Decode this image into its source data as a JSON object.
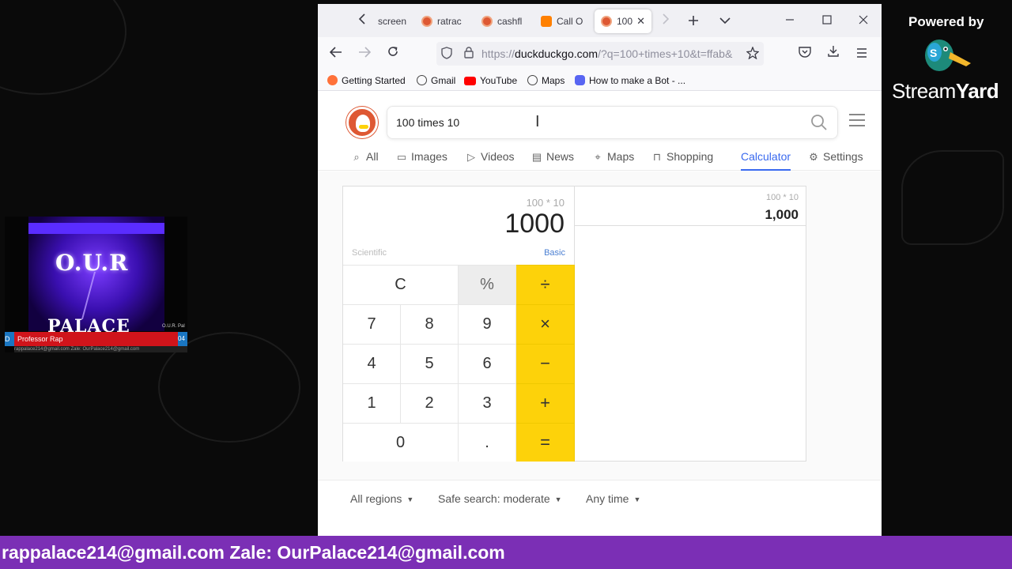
{
  "overlay": {
    "powered_by": "Powered by",
    "brand_light": "Stream",
    "brand_bold": "Yard",
    "footer_text": "rappalace214@gmail.com Zale: OurPalace214@gmail.com",
    "colors": {
      "footer_bg": "#7b2fb5",
      "lower_third": "#d0141b"
    }
  },
  "camera": {
    "title_line1": "O.U.R",
    "title_line2": "PALACE",
    "corner_text": "O.U.R. Pal",
    "lower_third_left": "D",
    "lower_third_name": "Professor Rap",
    "lower_third_right": "04",
    "ticker": "rappalace214@gmail.com Zale: OurPalace214@gmail.com"
  },
  "browser": {
    "tabs": [
      {
        "label": "screen",
        "icon": "generic-icon",
        "active": false
      },
      {
        "label": "ratrac",
        "icon": "duckduckgo-icon",
        "active": false
      },
      {
        "label": "cashfl",
        "icon": "duckduckgo-icon",
        "active": false
      },
      {
        "label": "Call O",
        "icon": "blogger-icon",
        "active": false
      },
      {
        "label": "100",
        "icon": "duckduckgo-icon",
        "active": true
      }
    ],
    "url_prefix": "https://",
    "url_host": "duckduckgo.com",
    "url_rest": "/?q=100+times+10&t=ffab&",
    "bookmarks": [
      {
        "label": "Getting Started",
        "icon": "firefox-icon",
        "color": "#ff7139"
      },
      {
        "label": "Gmail",
        "icon": "globe-icon",
        "color": "#ffffff"
      },
      {
        "label": "YouTube",
        "icon": "youtube-icon",
        "color": "#ff0000"
      },
      {
        "label": "Maps",
        "icon": "globe-icon",
        "color": "#ffffff"
      },
      {
        "label": "How to make a Bot - ...",
        "icon": "discord-icon",
        "color": "#5865f2"
      }
    ]
  },
  "search": {
    "query": "100 times 10",
    "tabs": [
      {
        "label": "All",
        "icon": "search-icon"
      },
      {
        "label": "Images",
        "icon": "image-icon"
      },
      {
        "label": "Videos",
        "icon": "play-icon"
      },
      {
        "label": "News",
        "icon": "news-icon"
      },
      {
        "label": "Maps",
        "icon": "pin-icon"
      },
      {
        "label": "Shopping",
        "icon": "bag-icon"
      },
      {
        "label": "Calculator",
        "icon": "",
        "active": true
      },
      {
        "label": "Settings",
        "icon": "sliders-icon"
      }
    ],
    "accent": "#3969ef"
  },
  "calculator": {
    "expression": "100 * 10",
    "result": "1000",
    "mode_left": "Scientific",
    "mode_right": "Basic",
    "keys": {
      "clear": "C",
      "percent": "%",
      "divide": "÷",
      "seven": "7",
      "eight": "8",
      "nine": "9",
      "multiply": "×",
      "four": "4",
      "five": "5",
      "six": "6",
      "minus": "−",
      "one": "1",
      "two": "2",
      "three": "3",
      "plus": "+",
      "zero": "0",
      "decimal": ".",
      "equals": "="
    },
    "history": [
      {
        "expression": "100 * 10",
        "result": "1,000"
      }
    ],
    "op_color": "#fdd20a"
  },
  "filters": {
    "region": "All regions",
    "safe_search": "Safe search: moderate",
    "time": "Any time"
  }
}
